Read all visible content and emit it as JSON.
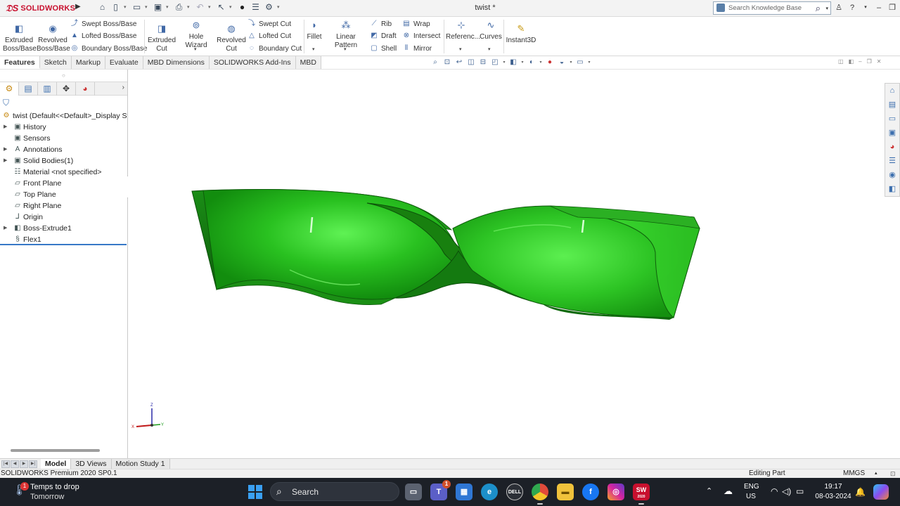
{
  "titlebar": {
    "app_logo": "SOLIDWORKS",
    "doc_title": "twist *",
    "search_placeholder": "Search Knowledge Base",
    "quick_access_icons": [
      "home-icon",
      "new-icon",
      "open-icon",
      "save-icon",
      "print-icon",
      "undo-icon",
      "select-icon",
      "rebuild-icon",
      "file-properties-icon",
      "options-icon"
    ]
  },
  "commands": {
    "extruded_boss": "Extruded Boss/Base",
    "revolved_boss": "Revolved Boss/Base",
    "swept_boss": "Swept Boss/Base",
    "lofted_boss": "Lofted Boss/Base",
    "boundary_boss": "Boundary Boss/Base",
    "extruded_cut": "Extruded Cut",
    "hole_wizard": "Hole Wizard",
    "revolved_cut": "Revolved Cut",
    "swept_cut": "Swept Cut",
    "lofted_cut": "Lofted Cut",
    "boundary_cut": "Boundary Cut",
    "fillet": "Fillet",
    "linear_pattern": "Linear Pattern",
    "rib": "Rib",
    "draft": "Draft",
    "shell": "Shell",
    "wrap": "Wrap",
    "intersect": "Intersect",
    "mirror": "Mirror",
    "reference": "Referenc...",
    "curves": "Curves",
    "instant3d": "Instant3D"
  },
  "tabs": [
    "Features",
    "Sketch",
    "Markup",
    "Evaluate",
    "MBD Dimensions",
    "SOLIDWORKS Add-Ins",
    "MBD"
  ],
  "active_tab": "Features",
  "feature_tree": {
    "root": "twist  (Default<<Default>_Display St",
    "items": [
      {
        "label": "History",
        "icon": "history-folder-icon",
        "expandable": true
      },
      {
        "label": "Sensors",
        "icon": "sensors-icon",
        "expandable": false
      },
      {
        "label": "Annotations",
        "icon": "annotations-icon",
        "expandable": true
      },
      {
        "label": "Solid Bodies(1)",
        "icon": "solid-bodies-icon",
        "expandable": true
      },
      {
        "label": "Material <not specified>",
        "icon": "material-icon",
        "expandable": false
      },
      {
        "label": "Front Plane",
        "icon": "plane-icon",
        "expandable": false
      },
      {
        "label": "Top Plane",
        "icon": "plane-icon",
        "expandable": false
      },
      {
        "label": "Right Plane",
        "icon": "plane-icon",
        "expandable": false
      },
      {
        "label": "Origin",
        "icon": "origin-icon",
        "expandable": false
      },
      {
        "label": "Boss-Extrude1",
        "icon": "extrude-feature-icon",
        "expandable": true
      },
      {
        "label": "Flex1",
        "icon": "flex-feature-icon",
        "expandable": false
      }
    ]
  },
  "model": {
    "color": "#1f9e1a",
    "shape": "twisted rectangular bar"
  },
  "triad": {
    "x": "X",
    "y": "Y",
    "z": "Z"
  },
  "bottom_tabs": [
    "Model",
    "3D Views",
    "Motion Study 1"
  ],
  "active_bottom_tab": "Model",
  "status": {
    "left": "SOLIDWORKS Premium 2020 SP0.1",
    "mode": "Editing Part",
    "units": "MMGS"
  },
  "taskbar": {
    "weather_line1": "Temps to drop",
    "weather_line2": "Tomorrow",
    "weather_badge": "1",
    "search": "Search",
    "teams_badge": "1",
    "lang1": "ENG",
    "lang2": "US",
    "time": "19:17",
    "date": "08-03-2024",
    "solidworks_icon_label": "SW",
    "solidworks_icon_year": "2020"
  }
}
